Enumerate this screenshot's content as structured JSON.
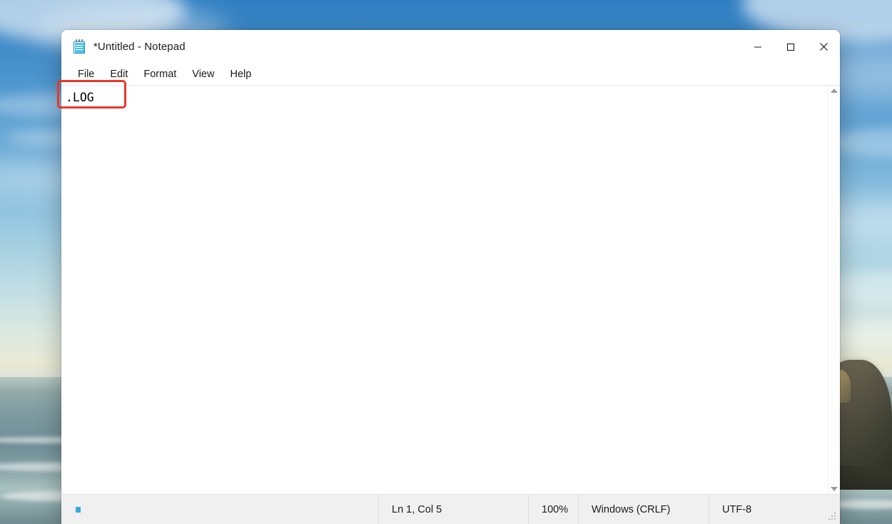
{
  "desktop": {
    "wallpaper_description": "beach-with-sea-stack",
    "sky_color": "#4a93cd",
    "sea_color": "#7d9aa0",
    "rock_color": "#3f4034"
  },
  "window": {
    "title": "*Untitled - Notepad",
    "icon": "notepad-icon",
    "controls": {
      "minimize_label": "Minimize",
      "maximize_label": "Maximize",
      "close_label": "Close"
    }
  },
  "menubar": {
    "items": [
      {
        "label": "File"
      },
      {
        "label": "Edit"
      },
      {
        "label": "Format"
      },
      {
        "label": "View"
      },
      {
        "label": "Help"
      }
    ]
  },
  "editor": {
    "content": ".LOG",
    "placeholder": ""
  },
  "scrollbar": {
    "up_arrow": "triangle-up-icon",
    "down_arrow": "triangle-down-icon"
  },
  "statusbar": {
    "position": "Ln 1, Col 5",
    "zoom": "100%",
    "line_ending": "Windows (CRLF)",
    "encoding": "UTF-8"
  },
  "annotation": {
    "highlight_color": "#e8372a",
    "highlight_target": ".LOG"
  }
}
